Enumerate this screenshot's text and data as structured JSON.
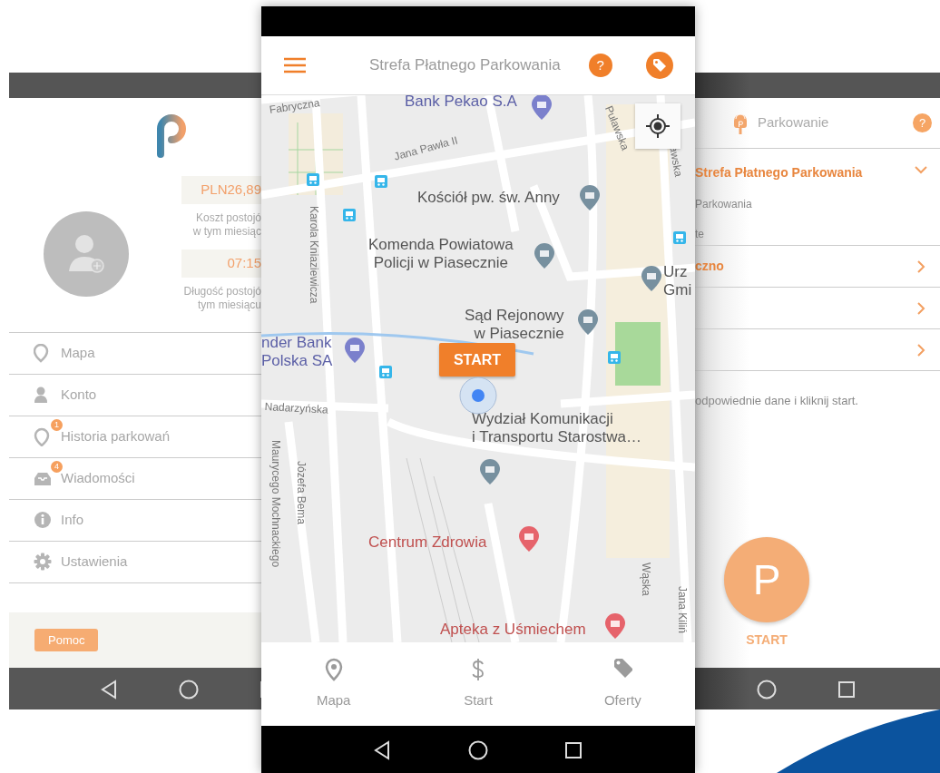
{
  "left_screen": {
    "stats": [
      {
        "value": "PLN26,89",
        "caption": [
          "Koszt postojó",
          "w tym miesiąc"
        ]
      },
      {
        "value": "07:15",
        "caption": [
          "Długość postojó",
          "tym miesiącu"
        ]
      }
    ],
    "menu": [
      {
        "label": "Mapa"
      },
      {
        "label": "Konto"
      },
      {
        "label": "Historia parkowań",
        "badge": "1"
      },
      {
        "label": "Wiadomości",
        "badge": "4"
      },
      {
        "label": "Info"
      },
      {
        "label": "Ustawienia"
      }
    ],
    "help_button": "Pomoc"
  },
  "center_screen": {
    "header": {
      "title": "Strefa Płatnego Parkowania",
      "help": "?"
    },
    "map": {
      "labels": [
        {
          "text": "Fabryczna",
          "kind": "street"
        },
        {
          "text": "Bank Pekao S.A",
          "kind": "bank",
          "color": "#5b5fa6"
        },
        {
          "text": "Puławska",
          "kind": "street"
        },
        {
          "text": "awska",
          "kind": "street"
        },
        {
          "text": "Jana Pawła II",
          "kind": "street"
        },
        {
          "text": "Kościół pw. św. Anny",
          "kind": "place",
          "color": "#555555"
        },
        {
          "text": "Karola Kniaziewicza",
          "kind": "street"
        },
        {
          "text": "Komenda Powiatowa\nPolicji w Piasecznie",
          "kind": "place",
          "color": "#555555"
        },
        {
          "text": "Urz\nGmi",
          "kind": "place",
          "color": "#555555"
        },
        {
          "text": "Sąd Rejonowy\nw Piasecznie",
          "kind": "place",
          "color": "#555555"
        },
        {
          "text": "nder Bank\nPolska SA",
          "kind": "bank",
          "color": "#5b5fa6"
        },
        {
          "text": "Nadarzyńska",
          "kind": "street"
        },
        {
          "text": "Maurycego Mochnackiego",
          "kind": "street"
        },
        {
          "text": "Józefa Bema",
          "kind": "street"
        },
        {
          "text": "Wydział Komunikacji\ni Transportu Starostwa…",
          "kind": "place",
          "color": "#555555"
        },
        {
          "text": "Centrum Zdrowia",
          "kind": "health",
          "color": "#c0504f"
        },
        {
          "text": "Wąska",
          "kind": "street"
        },
        {
          "text": "Jana Kiliń",
          "kind": "street"
        },
        {
          "text": "Apteka z Uśmiechem",
          "kind": "health",
          "color": "#c0504f"
        }
      ],
      "start_callout": "START"
    },
    "tabs": [
      {
        "label": "Mapa",
        "selected": false
      },
      {
        "label": "Start",
        "selected": false
      },
      {
        "label": "Oferty",
        "selected": false
      }
    ]
  },
  "right_screen": {
    "header": {
      "title": "Parkowanie",
      "help": "?"
    },
    "sections": [
      {
        "title": "Strefa Płatnego Parkowania",
        "expanded": true,
        "lines": [
          "Parkowania",
          "te"
        ]
      },
      {
        "title": "czno",
        "expanded": false
      },
      {
        "expanded": false
      },
      {
        "expanded": false
      }
    ],
    "hint": "odpowiednie dane i kliknij start.",
    "start_button": {
      "symbol": "P",
      "label": "START"
    }
  }
}
